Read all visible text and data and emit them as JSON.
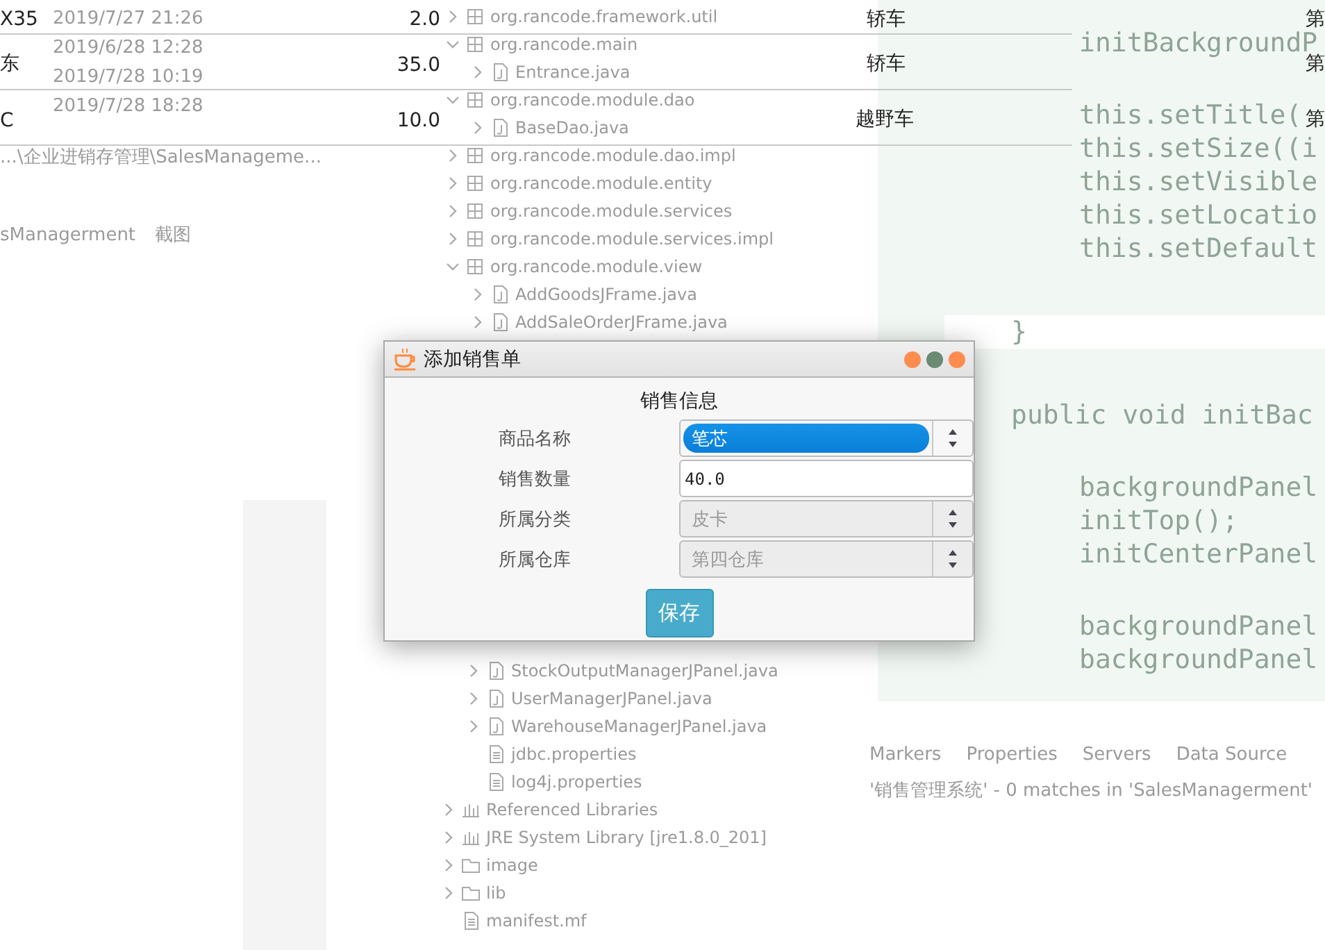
{
  "file_list": {
    "dates": [
      "2019/7/27 21:26",
      "2019/6/28 12:28",
      "2019/7/28 10:19",
      "2019/7/28 18:28"
    ],
    "path": "...\\企业进销存管理\\SalesManageme...",
    "breadcrumb": [
      "sManagerment",
      "截图"
    ]
  },
  "project_tree": {
    "upper": [
      {
        "label": "org.rancode.framework.util",
        "kind": "package",
        "expanded": false
      },
      {
        "label": "org.rancode.main",
        "kind": "package",
        "expanded": true,
        "children": [
          {
            "label": "Entrance.java",
            "kind": "java"
          }
        ]
      },
      {
        "label": "org.rancode.module.dao",
        "kind": "package",
        "expanded": true,
        "children": [
          {
            "label": "BaseDao.java",
            "kind": "java"
          }
        ]
      },
      {
        "label": "org.rancode.module.dao.impl",
        "kind": "package",
        "expanded": false
      },
      {
        "label": "org.rancode.module.entity",
        "kind": "package",
        "expanded": false
      },
      {
        "label": "org.rancode.module.services",
        "kind": "package",
        "expanded": false
      },
      {
        "label": "org.rancode.module.services.impl",
        "kind": "package",
        "expanded": false
      },
      {
        "label": "org.rancode.module.view",
        "kind": "package",
        "expanded": true,
        "children": [
          {
            "label": "AddGoodsJFrame.java",
            "kind": "java"
          },
          {
            "label": "AddSaleOrderJFrame.java",
            "kind": "java"
          }
        ]
      }
    ],
    "lower": [
      {
        "label": "StockOutputManagerJPanel.java",
        "kind": "java"
      },
      {
        "label": "UserManagerJPanel.java",
        "kind": "java"
      },
      {
        "label": "WarehouseManagerJPanel.java",
        "kind": "java"
      },
      {
        "label": "jdbc.properties",
        "kind": "file"
      },
      {
        "label": "log4j.properties",
        "kind": "file"
      }
    ],
    "project": [
      {
        "label": "Referenced Libraries",
        "kind": "library"
      },
      {
        "label": "JRE System Library",
        "note": "[jre1.8.0_201]",
        "kind": "library"
      },
      {
        "label": "image",
        "kind": "folder"
      },
      {
        "label": "lib",
        "kind": "folder"
      },
      {
        "label": "manifest.mf",
        "kind": "file"
      }
    ]
  },
  "code": {
    "upper": [
      [
        "initBackgroundP"
      ],
      [
        "this.setTitle(",
        "this.setSize((i",
        "this.setVisible",
        "this.setLocatio",
        "this.setDefault"
      ]
    ],
    "closing": "}",
    "lower": [
      [
        "public void initBac"
      ],
      [
        "backgroundPanel",
        "initTop();",
        "initCenterPanel"
      ],
      [
        "backgroundPanel",
        "backgroundPanel"
      ]
    ]
  },
  "bottom_panel": {
    "tabs": [
      "Markers",
      "Properties",
      "Servers",
      "Data Source"
    ],
    "status": "'销售管理系统' - 0 matches in 'SalesManagerment'"
  },
  "table": {
    "rows": [
      {
        "cells": [
          "X35",
          "2.0",
          "轿车",
          "第"
        ]
      },
      {
        "cells": [
          "东",
          "35.0",
          "轿车",
          "第"
        ]
      },
      {
        "cells": [
          "C",
          "10.0",
          "越野车",
          "第"
        ]
      }
    ]
  },
  "dialog": {
    "title": "添加销售单",
    "heading": "销售信息",
    "fields": [
      {
        "label": "商品名称",
        "kind": "combo",
        "value": "笔芯",
        "disabled": false,
        "highlighted": true
      },
      {
        "label": "销售数量",
        "kind": "text",
        "value": "40.0",
        "disabled": false
      },
      {
        "label": "所属分类",
        "kind": "combo",
        "value": "皮卡",
        "disabled": true,
        "highlighted": false
      },
      {
        "label": "所属仓库",
        "kind": "combo",
        "value": "第四仓库",
        "disabled": true,
        "highlighted": false
      }
    ],
    "button": "保存"
  }
}
